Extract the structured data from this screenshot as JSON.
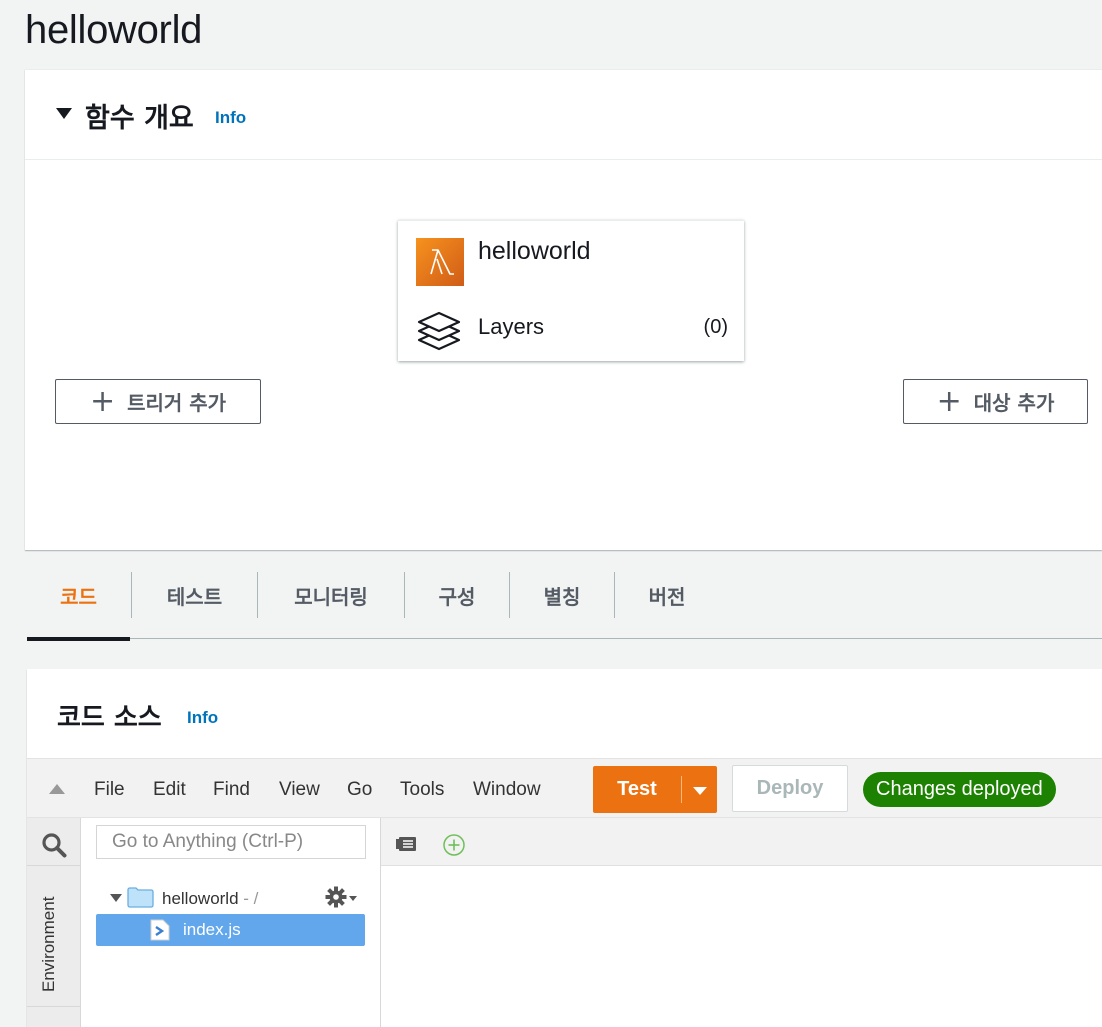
{
  "page": {
    "title": "helloworld"
  },
  "overview": {
    "title": "함수 개요",
    "info": "Info",
    "function_name": "helloworld",
    "layers_label": "Layers",
    "layers_count": "(0)",
    "add_trigger": "트리거 추가",
    "add_destination": "대상 추가"
  },
  "tabs": [
    {
      "label": "코드",
      "active": true
    },
    {
      "label": "테스트"
    },
    {
      "label": "모니터링"
    },
    {
      "label": "구성"
    },
    {
      "label": "별칭"
    },
    {
      "label": "버전"
    }
  ],
  "code_source": {
    "title": "코드 소스",
    "info": "Info",
    "menu": [
      "File",
      "Edit",
      "Find",
      "View",
      "Go",
      "Tools",
      "Window"
    ],
    "test_label": "Test",
    "deploy_label": "Deploy",
    "status": "Changes deployed",
    "search_placeholder": "Go to Anything (Ctrl-P)",
    "environment_label": "Environment",
    "tree": {
      "folder": "helloworld",
      "folder_path": " - /",
      "file": "index.js"
    }
  },
  "colors": {
    "accent_orange": "#ec7211",
    "link_blue": "#0073bb",
    "success_green": "#1d8102",
    "selection_blue": "#62a7ec"
  },
  "icons": [
    "lambda-icon",
    "layers-icon",
    "plus-icon",
    "search-icon",
    "folder-icon",
    "gear-icon",
    "file-js-icon",
    "tab-list-icon",
    "new-tab-icon"
  ]
}
